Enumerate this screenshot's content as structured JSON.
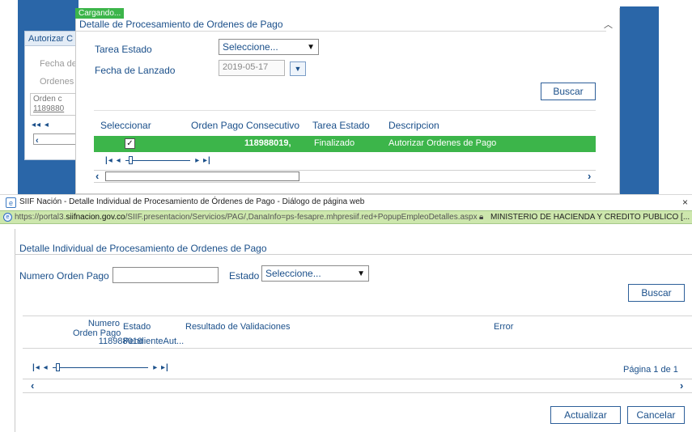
{
  "background_page": {
    "panel_title": "Autorizar C",
    "fecha_label": "Fecha de",
    "ordenes_label": "Ordenes",
    "orden_col": "Orden c",
    "orden_val": "1189880"
  },
  "top_dialog": {
    "status_badge": "Cargando...",
    "title": "Detalle de Procesamiento de Ordenes de Pago",
    "tarea_estado_label": "Tarea Estado",
    "tarea_estado_value": "Seleccione...",
    "fecha_label": "Fecha de Lanzado",
    "fecha_value": "2019-05-17",
    "buscar_label": "Buscar",
    "columns": [
      "Seleccionar",
      "Orden Pago Consecutivo",
      "Tarea Estado",
      "Descripcion"
    ],
    "row": {
      "checked_glyph": "✓",
      "consecutivo": "118988019,",
      "estado": "Finalizado",
      "descripcion": "Autorizar Ordenes de Pago"
    }
  },
  "window": {
    "title": "SIIF Nación - Detalle Individual de Procesamiento de Órdenes de Pago - Diálogo de página web",
    "close_glyph": "×",
    "url_prefix": "https://portal3.",
    "url_domain": "siifnacion.gov.co",
    "url_rest": "/SIIF.presentacion/Servicios/PAG/,DanaInfo=ps-fesapre.mhpresiif.red+PopupEmpleoDetalles.aspx",
    "cert_label": "MINISTERIO DE HACIENDA Y CREDITO PUBLICO [..."
  },
  "bottom_dialog": {
    "title": "Detalle Individual de Procesamiento de Ordenes de Pago",
    "numero_label": "Numero Orden Pago",
    "numero_value": "",
    "estado_label": "Estado",
    "estado_value": "Seleccione...",
    "buscar_label": "Buscar",
    "columns": {
      "numero_line1": "Numero",
      "numero_line2": "Orden Pago",
      "estado": "Estado",
      "resultado": "Resultado de Validaciones",
      "error": "Error"
    },
    "rows": [
      {
        "numero": "118988019",
        "estado": "PendienteAut..."
      }
    ],
    "page_info": "Página 1 de 1",
    "actualizar_label": "Actualizar",
    "cancelar_label": "Cancelar"
  }
}
